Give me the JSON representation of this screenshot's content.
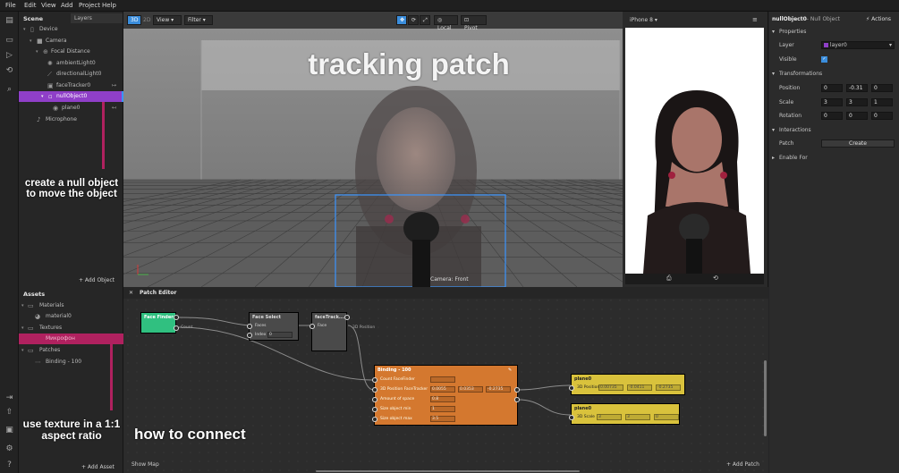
{
  "menubar": {
    "items": [
      "File",
      "Edit",
      "View",
      "Add",
      "Project",
      "Help"
    ]
  },
  "scene": {
    "title": "Scene",
    "tab": "Layers",
    "tree": [
      {
        "label": "Device"
      },
      {
        "label": "Camera"
      },
      {
        "label": "Focal Distance"
      },
      {
        "label": "ambientLight0"
      },
      {
        "label": "directionalLight0"
      },
      {
        "label": "faceTracker0"
      },
      {
        "label": "nullObject0"
      },
      {
        "label": "plane0"
      },
      {
        "label": "Microphone"
      }
    ],
    "add_label": "+ Add Object",
    "annotation": "create a null object to move the object"
  },
  "viewport": {
    "toggle3d": "3D",
    "toggle2d": "2D",
    "view": "View",
    "filter": "Filter",
    "local": "Local",
    "pivot": "Pivot",
    "camera_label": "Camera: Front",
    "overlay_title": "tracking patch"
  },
  "preview": {
    "device": "iPhone 8"
  },
  "properties": {
    "object_name": "nullObject0",
    "object_type": "– Null Object",
    "actions": "Actions",
    "section_properties": "Properties",
    "layer_label": "Layer",
    "layer_value": "layer0",
    "visible_label": "Visible",
    "section_transformations": "Transformations",
    "position_label": "Position",
    "position": [
      "0",
      "-0.31",
      "0"
    ],
    "scale_label": "Scale",
    "scale": [
      "3",
      "3",
      "1"
    ],
    "rotation_label": "Rotation",
    "rotation": [
      "0",
      "0",
      "0"
    ],
    "section_interactions": "Interactions",
    "patch_label": "Patch",
    "create_label": "Create",
    "section_enable": "Enable For"
  },
  "assets": {
    "title": "Assets",
    "items": [
      {
        "label": "Materials"
      },
      {
        "label": "material0"
      },
      {
        "label": "Textures"
      },
      {
        "label": "Микрофон"
      },
      {
        "label": "Patches"
      },
      {
        "label": "Binding - 100"
      }
    ],
    "add_label": "+ Add Asset",
    "annotation": "use texture in a 1:1 aspect ratio"
  },
  "patch_editor": {
    "title": "Patch Editor",
    "show_map": "Show Map",
    "add_patch": "+ Add Patch",
    "annotation": "how to connect",
    "face_finder": {
      "title": "Face Finder",
      "out": "Count"
    },
    "face_select": {
      "title": "Face Select",
      "in_faces": "Faces",
      "in_index": "Index",
      "index_value": "0"
    },
    "face_tracker": {
      "title": "faceTrack...",
      "in_face": "Face",
      "out": "3D Position"
    },
    "binding": {
      "title": "Binding - 100",
      "rows": [
        {
          "label": "Count FaceFinder",
          "values": [
            ""
          ]
        },
        {
          "label": "3D Position FaceTracker",
          "values": [
            "0.0055",
            "0.0353",
            "-0.2735"
          ]
        },
        {
          "label": "Amount of space",
          "values": [
            "0.8"
          ]
        },
        {
          "label": "Size object min",
          "values": [
            "1"
          ]
        },
        {
          "label": "Size object max",
          "values": [
            "3.5"
          ]
        }
      ]
    },
    "plane_pos": {
      "title": "plane0",
      "label": "3D Position",
      "values": [
        "0.00735",
        "-0.0411",
        "-0.2735"
      ]
    },
    "plane_scale": {
      "title": "plane0",
      "label": "3D Scale",
      "values": [
        "3",
        "3",
        "0"
      ]
    }
  }
}
